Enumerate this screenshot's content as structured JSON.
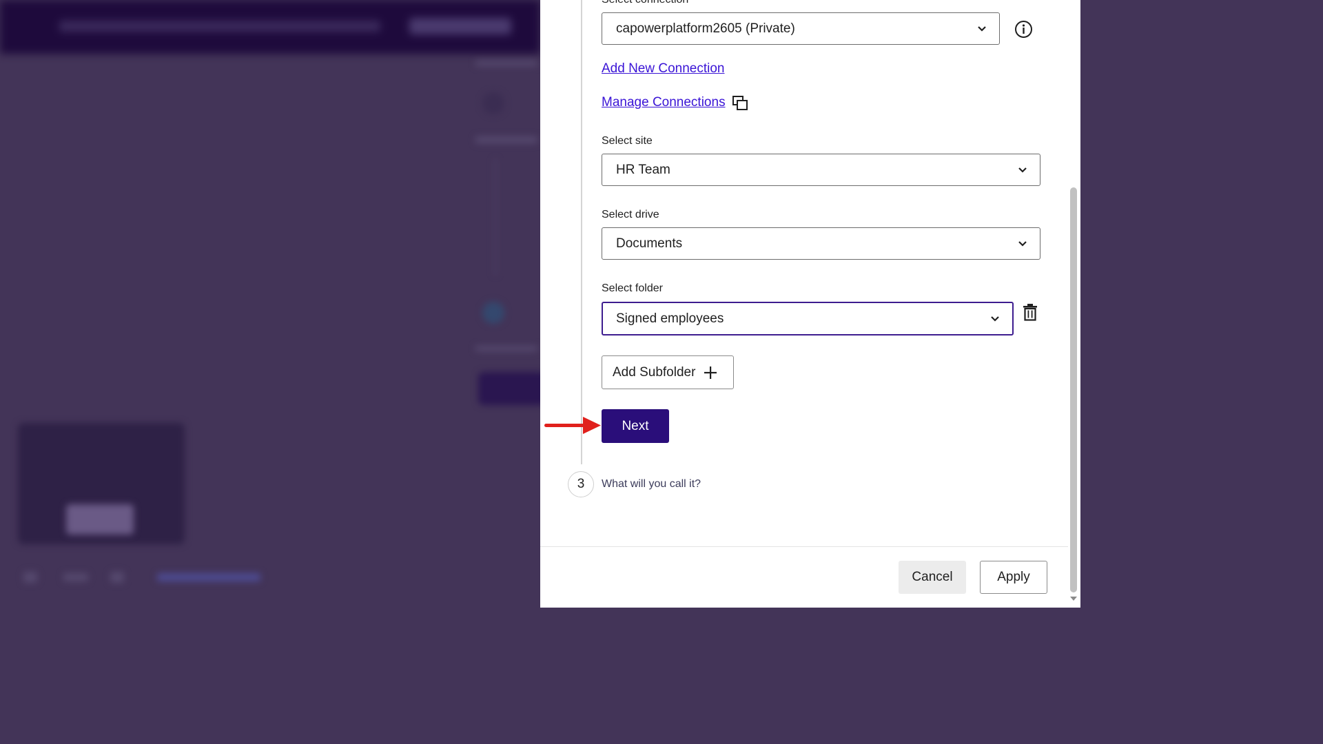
{
  "connection": {
    "label": "Select connection",
    "value": "capowerplatform2605 (Private)",
    "add_link": "Add New Connection",
    "manage_link": "Manage Connections"
  },
  "site": {
    "label": "Select site",
    "value": "HR Team"
  },
  "drive": {
    "label": "Select drive",
    "value": "Documents"
  },
  "folder": {
    "label": "Select folder",
    "value": "Signed employees"
  },
  "add_subfolder": "Add Subfolder",
  "next_label": "Next",
  "step3": {
    "number": "3",
    "title": "What will you call it?"
  },
  "footer": {
    "cancel": "Cancel",
    "apply": "Apply"
  },
  "icons": {
    "info": "info-icon",
    "external": "open-external-icon",
    "delete": "trash-icon",
    "add": "plus-icon",
    "chevron": "chevron-down-icon",
    "annotation": "red-arrow-icon"
  },
  "colors": {
    "primary": "#2a0e7a",
    "link": "#3a14d6",
    "focus": "#3d1c8f",
    "annotation": "#e0201c",
    "overlay": "#433458"
  }
}
